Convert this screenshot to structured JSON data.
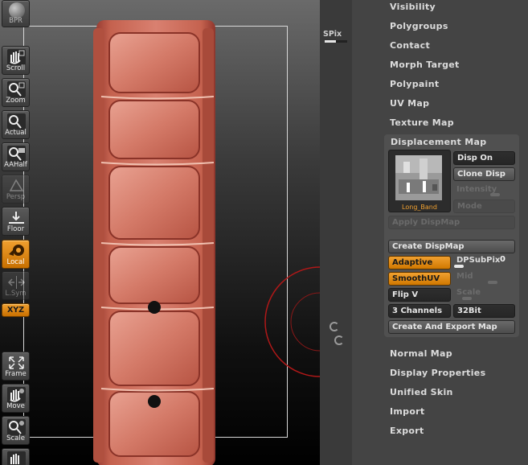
{
  "toolbar": {
    "bpr": "BPR",
    "spix": "SPix",
    "scroll": "Scroll",
    "zoom": "Zoom",
    "actual": "Actual",
    "aahalf": "AAHalf",
    "persp": "Persp",
    "floor": "Floor",
    "local": "Local",
    "lsym": "L.Sym",
    "xyz": "XYZ",
    "frame": "Frame",
    "move": "Move",
    "scale": "Scale"
  },
  "menu": {
    "visibility": "Visibility",
    "polygroups": "Polygroups",
    "contact": "Contact",
    "morph_target": "Morph Target",
    "polypaint": "Polypaint",
    "uv_map": "UV Map",
    "texture_map": "Texture Map",
    "normal_map": "Normal Map",
    "display_properties": "Display Properties",
    "unified_skin": "Unified Skin",
    "import": "Import",
    "export": "Export"
  },
  "displacement": {
    "title": "Displacement Map",
    "thumbnail_label": "Long_Band",
    "disp_on": "Disp On",
    "clone_disp": "Clone Disp",
    "intensity": "Intensity",
    "mode": "Mode",
    "apply_dispmap": "Apply DispMap",
    "create_dispmap": "Create DispMap",
    "adaptive": "Adaptive",
    "dpsubpix_label": "DPSubPix",
    "dpsubpix_value": "0",
    "smoothuv": "SmoothUV",
    "mid": "Mid",
    "flip_v": "Flip V",
    "scale": "Scale",
    "channels": "3 Channels",
    "bit_depth": "32Bit",
    "create_export": "Create And Export Map"
  },
  "colors": {
    "accent_orange": "#f0a030",
    "panel_bg": "#444444",
    "model_red": "#c05a4c"
  }
}
